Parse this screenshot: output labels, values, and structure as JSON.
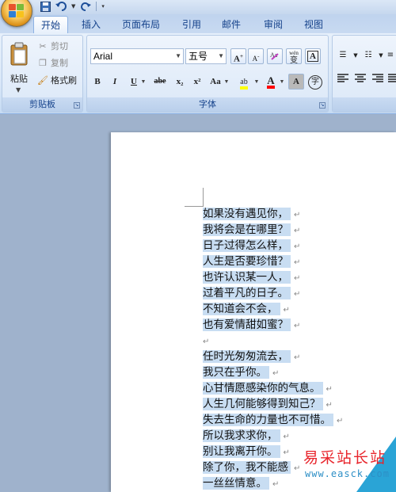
{
  "tabs": [
    "开始",
    "插入",
    "页面布局",
    "引用",
    "邮件",
    "审阅",
    "视图"
  ],
  "clipboard": {
    "paste": "粘贴",
    "cut": "剪切",
    "copy": "复制",
    "format_painter": "格式刷",
    "group_label": "剪贴板"
  },
  "font": {
    "font_name": "Arial",
    "font_size": "五号",
    "group_label": "字体",
    "bold": "B",
    "italic": "I",
    "underline": "U",
    "strike": "abe",
    "subscript": "x₂",
    "superscript": "x²",
    "change_case": "Aa",
    "grow": "A",
    "shrink": "A",
    "clear": "A",
    "phonetic": "wén",
    "phonetic_char": "变",
    "char_border": "A",
    "highlight": "ab",
    "font_color": "A",
    "char_shading": "A",
    "enclose": "字"
  },
  "document": {
    "lines": [
      "如果没有遇见你，",
      "我将会是在哪里？",
      "日子过得怎么样，",
      "人生是否要珍惜？",
      "也许认识某一人，",
      "过着平凡的日子。",
      "不知道会不会，",
      "也有爱情甜如蜜？",
      "",
      "任时光匆匆流去，",
      "我只在乎你。",
      "心甘情愿感染你的气息。",
      "人生几何能够得到知己？",
      "失去生命的力量也不可惜。",
      "所以我求求你，",
      "别让我离开你。",
      "除了你，我不能感",
      "一丝丝情意。"
    ],
    "paragraph_mark": "↵"
  },
  "watermark": {
    "text": "易采站长站",
    "url": "www.easck.com"
  },
  "colors": {
    "highlight": "#ffff00",
    "font_color": "#ff0000",
    "selection": "#c8ddf2"
  }
}
